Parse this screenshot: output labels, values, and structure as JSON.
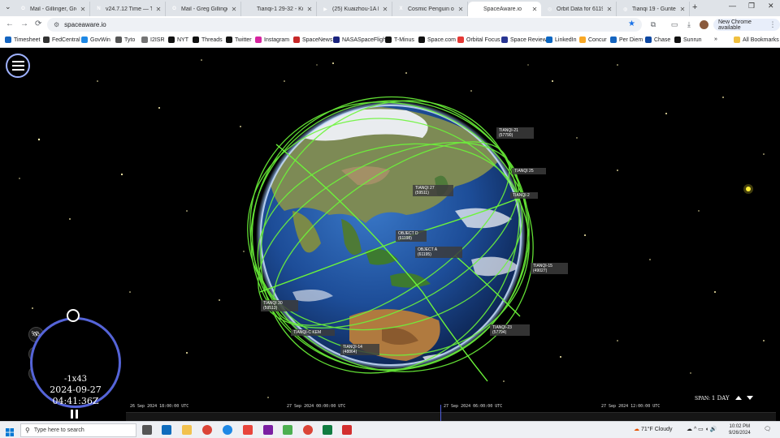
{
  "browser": {
    "tabs": [
      {
        "title": "Mail - Gillinger, Greg",
        "favicon": "outlook-icon",
        "color": "#0f6cbd",
        "active": false
      },
      {
        "title": "v24.7.12 Time — Tim",
        "favicon": "nasa-icon",
        "color": "#2e7d32",
        "active": false
      },
      {
        "title": "Mail - Greg Gillinger",
        "favicon": "outlook-icon",
        "color": "#0f6cbd",
        "active": false
      },
      {
        "title": "Tianqi-1 29-32 - Kua",
        "favicon": "page-icon",
        "color": "#3949ab",
        "active": false
      },
      {
        "title": "(25) Kuaizhou-1A lau",
        "favicon": "youtube-icon",
        "color": "#e53935",
        "active": false
      },
      {
        "title": "Cosmic Penguin on X",
        "favicon": "x-icon",
        "color": "#111111",
        "active": false
      },
      {
        "title": "SpaceAware.io",
        "favicon": "globe-icon",
        "color": "#777777",
        "active": true
      },
      {
        "title": "Orbit Data for 61195",
        "favicon": "orbit-icon",
        "color": "#5c6bc0",
        "active": false
      },
      {
        "title": "Tianqi 19 - Gunter's S",
        "favicon": "globe-icon",
        "color": "#777777",
        "active": false
      }
    ],
    "url": "spaceaware.io",
    "new_chrome_label": "New Chrome available",
    "bookmarks": [
      {
        "label": "Timesheet",
        "color": "#1565c0"
      },
      {
        "label": "FedCentral",
        "color": "#333333"
      },
      {
        "label": "GovWin",
        "color": "#1e88e5"
      },
      {
        "label": "Tyto",
        "color": "#555555"
      },
      {
        "label": "I2ISR",
        "color": "#757575"
      },
      {
        "label": "NYT",
        "color": "#111111"
      },
      {
        "label": "Threads",
        "color": "#111111"
      },
      {
        "label": "Twitter",
        "color": "#111111"
      },
      {
        "label": "Instagram",
        "color": "#d6249f"
      },
      {
        "label": "SpaceNews",
        "color": "#c62828"
      },
      {
        "label": "NASASpaceFlight",
        "color": "#1a237e"
      },
      {
        "label": "T-Minus",
        "color": "#111111"
      },
      {
        "label": "Space.com",
        "color": "#111111"
      },
      {
        "label": "Orbital Focus",
        "color": "#e53935"
      },
      {
        "label": "Space Review",
        "color": "#283593"
      },
      {
        "label": "LinkedIn",
        "color": "#0a66c2"
      },
      {
        "label": "Concur",
        "color": "#f9a825"
      },
      {
        "label": "Per Diem",
        "color": "#1565c0"
      },
      {
        "label": "Chase",
        "color": "#0d47a1"
      },
      {
        "label": "Sunrun",
        "color": "#111111"
      }
    ],
    "all_bookmarks_label": "All Bookmarks"
  },
  "app": {
    "satellite_labels": [
      {
        "name": "TIANQI-21",
        "id": "(57790)"
      },
      {
        "name": "TIANQI 25",
        "id": ""
      },
      {
        "name": "TIANQI 2",
        "id": ""
      },
      {
        "name": "TIANQI 27",
        "id": "(59511)"
      },
      {
        "name": "OBJECT D",
        "id": "(61198)"
      },
      {
        "name": "OBJECT A",
        "id": "(61195)"
      },
      {
        "name": "TIANQI-15",
        "id": "(49027)"
      },
      {
        "name": "TIANQI 30",
        "id": "(59513)"
      },
      {
        "name": "TIANQI-23",
        "id": "(57794)"
      },
      {
        "name": "TIANQI-14",
        "id": "(48864)"
      },
      {
        "name": "TIANQI-C KEM",
        "id": ""
      }
    ],
    "clock": {
      "rate": "-1x43",
      "date": "2024-09-27",
      "time": "04:41:36Z"
    },
    "timeline": {
      "labels": [
        "26 Sep 2024 18:00:00 UTC",
        "27 Sep 2024 00:00:00 UTC",
        "27 Sep 2024 06:00:00 UTC",
        "27 Sep 2024 12:00:00 UTC"
      ],
      "span_label": "SPAN:",
      "span_value": "1 DAY"
    },
    "orbit_color": "#6cf53a",
    "accent_color": "#5564d8"
  },
  "taskbar": {
    "search_placeholder": "Type here to search",
    "weather": "71°F  Cloudy",
    "time": "10:02 PM",
    "date": "9/26/2024"
  }
}
